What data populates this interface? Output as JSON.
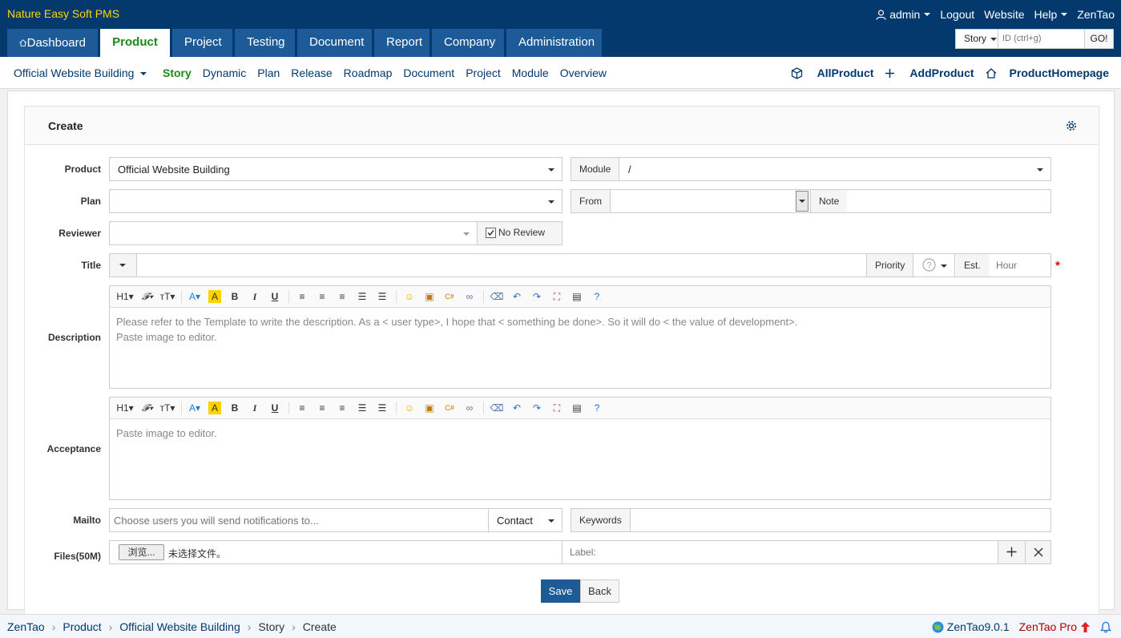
{
  "brand": "Nature Easy Soft PMS",
  "topnav": {
    "user": "admin",
    "logout": "Logout",
    "website": "Website",
    "help": "Help",
    "zentao": "ZenTao"
  },
  "mainnav": [
    "Dashboard",
    "Product",
    "Project",
    "Testing",
    "Document",
    "Report",
    "Company",
    "Administration"
  ],
  "search": {
    "type": "Story",
    "placeholder": "ID (ctrl+g)",
    "go": "GO!"
  },
  "subnav": {
    "product": "Official Website Building",
    "links": [
      "Story",
      "Dynamic",
      "Plan",
      "Release",
      "Roadmap",
      "Document",
      "Project",
      "Module",
      "Overview"
    ],
    "all_product": "AllProduct",
    "add_product": "AddProduct",
    "product_homepage": "ProductHomepage"
  },
  "form": {
    "title": "Create",
    "product_label": "Product",
    "product_value": "Official Website Building",
    "module_label": "Module",
    "module_value": "/",
    "plan_label": "Plan",
    "from_label": "From",
    "note_label": "Note",
    "reviewer_label": "Reviewer",
    "no_review": "No Review",
    "title_label": "Title",
    "priority_label": "Priority",
    "est_label": "Est.",
    "hour_placeholder": "Hour",
    "required_mark": "*",
    "description_label": "Description",
    "description_placeholder_1": "Please refer to the Template to write the description. As a < user type>, I hope that < something be done>. So it will do < the value of development>.",
    "description_placeholder_2": "Paste image to editor.",
    "acceptance_label": "Acceptance",
    "acceptance_placeholder": "Paste image to editor.",
    "mailto_label": "Mailto",
    "mailto_placeholder": "Choose users you will send notifications to...",
    "contact_label": "Contact",
    "keywords_label": "Keywords",
    "files_label": "Files(50M)",
    "browse_button": "浏览...",
    "no_file": "未选择文件。",
    "file_label_placeholder": "Label:",
    "save": "Save",
    "back": "Back"
  },
  "footer": {
    "crumbs": [
      "ZenTao",
      "Product",
      "Official Website Building",
      "Story",
      "Create"
    ],
    "version": "ZenTao9.0.1",
    "pro": "ZenTao Pro"
  }
}
